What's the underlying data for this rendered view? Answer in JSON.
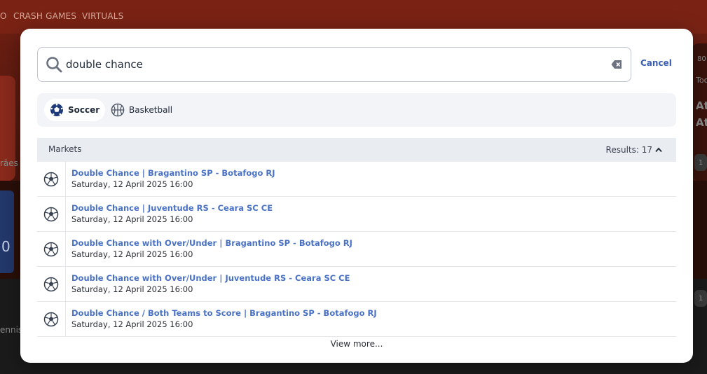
{
  "background": {
    "nav_items": [
      "O",
      "CRASH GAMES",
      "VIRTUALS"
    ],
    "left_fragments": [
      "rães",
      "ennis"
    ],
    "right_fragments": [
      "80",
      "Too",
      "At",
      "At",
      "1",
      "1"
    ],
    "left_pill": "0"
  },
  "search": {
    "value": "double chance",
    "cancel_label": "Cancel"
  },
  "sports": [
    {
      "label": "Soccer",
      "active": true,
      "icon": "soccer-ball-icon"
    },
    {
      "label": "Basketball",
      "active": false,
      "icon": "basketball-icon"
    }
  ],
  "markets": {
    "title": "Markets",
    "results_label": "Results: 17",
    "rows": [
      {
        "title": "Double Chance | Bragantino SP - Botafogo RJ",
        "date": "Saturday, 12 April 2025 16:00"
      },
      {
        "title": "Double Chance | Juventude RS - Ceara SC CE",
        "date": "Saturday, 12 April 2025 16:00"
      },
      {
        "title": "Double Chance with Over/Under | Bragantino SP - Botafogo RJ",
        "date": "Saturday, 12 April 2025 16:00"
      },
      {
        "title": "Double Chance with Over/Under | Juventude RS - Ceara SC CE",
        "date": "Saturday, 12 April 2025 16:00"
      },
      {
        "title": "Double Chance / Both Teams to Score | Bragantino SP - Botafogo RJ",
        "date": "Saturday, 12 April 2025 16:00"
      }
    ]
  },
  "view_more_label": "View more...",
  "colors": {
    "accent": "#4a72c4",
    "cancel": "#3a5fb0",
    "header_bg": "#e9ecf0",
    "filter_bg": "#f2f4f7"
  }
}
